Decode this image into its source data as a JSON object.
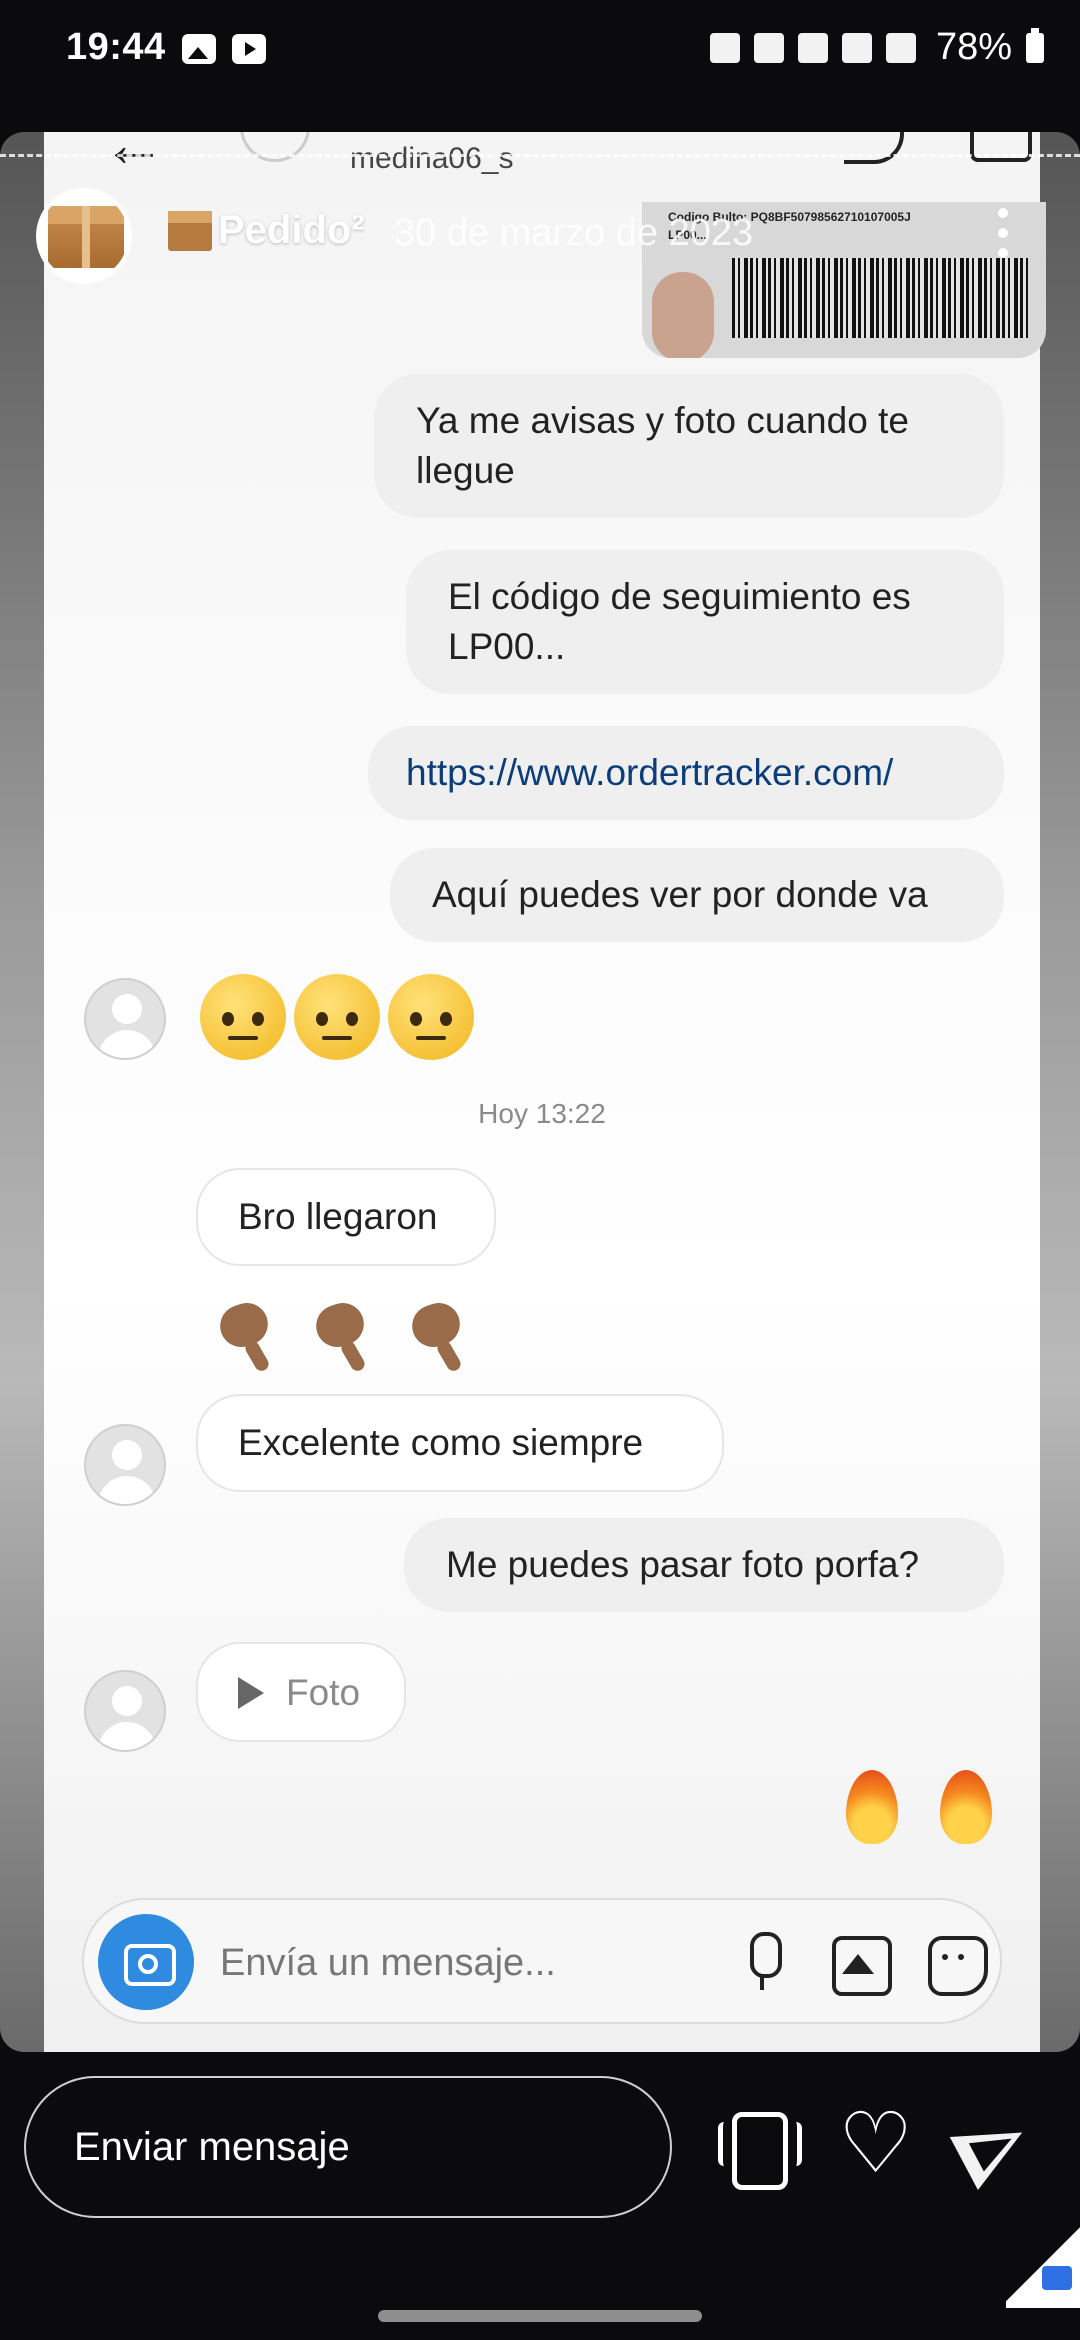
{
  "status_bar": {
    "time": "19:44",
    "battery": "78%"
  },
  "story": {
    "account_name": "Pedido²",
    "date": "30 de marzo de 2023"
  },
  "chat_header": {
    "username": "medina06_s"
  },
  "barcode": {
    "line1": "Codigo Bulto:  PQ8BF50798562710107005J",
    "line2": "LP00..."
  },
  "messages": {
    "m1": "Ya me avisas y foto cuando te llegue",
    "m2": "El código de seguimiento es LP00...",
    "m3": "https://www.ordertracker.com/",
    "m4": "Aquí puedes ver por donde va",
    "timestamp": "Hoy 13:22",
    "m5": "Bro llegaron",
    "m6": "Excelente como siempre",
    "m7": "Me puedes pasar foto porfa?",
    "m8": "Foto"
  },
  "composer": {
    "placeholder": "Envía un mensaje..."
  },
  "reply_bar": {
    "placeholder": "Enviar mensaje"
  },
  "colors": {
    "accent": "#2f8be0",
    "link": "#0b3d7a",
    "outgoing_bubble": "#efefef"
  },
  "icons": [
    "back-arrow-icon",
    "call-icon",
    "video-icon",
    "camera-icon",
    "mic-icon",
    "gallery-icon",
    "sticker-icon",
    "reels-icon",
    "heart-icon",
    "send-icon",
    "more-icon"
  ]
}
